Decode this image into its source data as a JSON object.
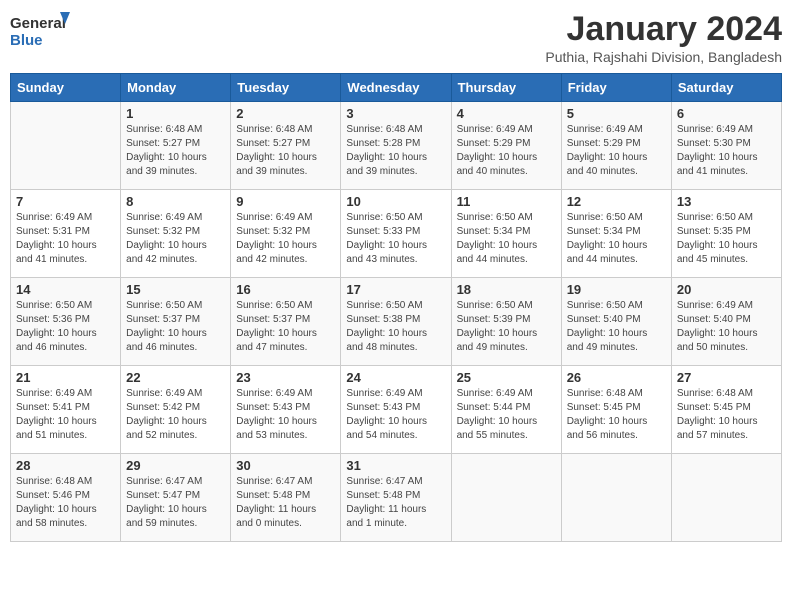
{
  "header": {
    "logo_line1": "General",
    "logo_line2": "Blue",
    "title": "January 2024",
    "subtitle": "Puthia, Rajshahi Division, Bangladesh"
  },
  "days_of_week": [
    "Sunday",
    "Monday",
    "Tuesday",
    "Wednesday",
    "Thursday",
    "Friday",
    "Saturday"
  ],
  "weeks": [
    [
      {
        "num": "",
        "info": ""
      },
      {
        "num": "1",
        "info": "Sunrise: 6:48 AM\nSunset: 5:27 PM\nDaylight: 10 hours\nand 39 minutes."
      },
      {
        "num": "2",
        "info": "Sunrise: 6:48 AM\nSunset: 5:27 PM\nDaylight: 10 hours\nand 39 minutes."
      },
      {
        "num": "3",
        "info": "Sunrise: 6:48 AM\nSunset: 5:28 PM\nDaylight: 10 hours\nand 39 minutes."
      },
      {
        "num": "4",
        "info": "Sunrise: 6:49 AM\nSunset: 5:29 PM\nDaylight: 10 hours\nand 40 minutes."
      },
      {
        "num": "5",
        "info": "Sunrise: 6:49 AM\nSunset: 5:29 PM\nDaylight: 10 hours\nand 40 minutes."
      },
      {
        "num": "6",
        "info": "Sunrise: 6:49 AM\nSunset: 5:30 PM\nDaylight: 10 hours\nand 41 minutes."
      }
    ],
    [
      {
        "num": "7",
        "info": "Sunrise: 6:49 AM\nSunset: 5:31 PM\nDaylight: 10 hours\nand 41 minutes."
      },
      {
        "num": "8",
        "info": "Sunrise: 6:49 AM\nSunset: 5:32 PM\nDaylight: 10 hours\nand 42 minutes."
      },
      {
        "num": "9",
        "info": "Sunrise: 6:49 AM\nSunset: 5:32 PM\nDaylight: 10 hours\nand 42 minutes."
      },
      {
        "num": "10",
        "info": "Sunrise: 6:50 AM\nSunset: 5:33 PM\nDaylight: 10 hours\nand 43 minutes."
      },
      {
        "num": "11",
        "info": "Sunrise: 6:50 AM\nSunset: 5:34 PM\nDaylight: 10 hours\nand 44 minutes."
      },
      {
        "num": "12",
        "info": "Sunrise: 6:50 AM\nSunset: 5:34 PM\nDaylight: 10 hours\nand 44 minutes."
      },
      {
        "num": "13",
        "info": "Sunrise: 6:50 AM\nSunset: 5:35 PM\nDaylight: 10 hours\nand 45 minutes."
      }
    ],
    [
      {
        "num": "14",
        "info": "Sunrise: 6:50 AM\nSunset: 5:36 PM\nDaylight: 10 hours\nand 46 minutes."
      },
      {
        "num": "15",
        "info": "Sunrise: 6:50 AM\nSunset: 5:37 PM\nDaylight: 10 hours\nand 46 minutes."
      },
      {
        "num": "16",
        "info": "Sunrise: 6:50 AM\nSunset: 5:37 PM\nDaylight: 10 hours\nand 47 minutes."
      },
      {
        "num": "17",
        "info": "Sunrise: 6:50 AM\nSunset: 5:38 PM\nDaylight: 10 hours\nand 48 minutes."
      },
      {
        "num": "18",
        "info": "Sunrise: 6:50 AM\nSunset: 5:39 PM\nDaylight: 10 hours\nand 49 minutes."
      },
      {
        "num": "19",
        "info": "Sunrise: 6:50 AM\nSunset: 5:40 PM\nDaylight: 10 hours\nand 49 minutes."
      },
      {
        "num": "20",
        "info": "Sunrise: 6:49 AM\nSunset: 5:40 PM\nDaylight: 10 hours\nand 50 minutes."
      }
    ],
    [
      {
        "num": "21",
        "info": "Sunrise: 6:49 AM\nSunset: 5:41 PM\nDaylight: 10 hours\nand 51 minutes."
      },
      {
        "num": "22",
        "info": "Sunrise: 6:49 AM\nSunset: 5:42 PM\nDaylight: 10 hours\nand 52 minutes."
      },
      {
        "num": "23",
        "info": "Sunrise: 6:49 AM\nSunset: 5:43 PM\nDaylight: 10 hours\nand 53 minutes."
      },
      {
        "num": "24",
        "info": "Sunrise: 6:49 AM\nSunset: 5:43 PM\nDaylight: 10 hours\nand 54 minutes."
      },
      {
        "num": "25",
        "info": "Sunrise: 6:49 AM\nSunset: 5:44 PM\nDaylight: 10 hours\nand 55 minutes."
      },
      {
        "num": "26",
        "info": "Sunrise: 6:48 AM\nSunset: 5:45 PM\nDaylight: 10 hours\nand 56 minutes."
      },
      {
        "num": "27",
        "info": "Sunrise: 6:48 AM\nSunset: 5:45 PM\nDaylight: 10 hours\nand 57 minutes."
      }
    ],
    [
      {
        "num": "28",
        "info": "Sunrise: 6:48 AM\nSunset: 5:46 PM\nDaylight: 10 hours\nand 58 minutes."
      },
      {
        "num": "29",
        "info": "Sunrise: 6:47 AM\nSunset: 5:47 PM\nDaylight: 10 hours\nand 59 minutes."
      },
      {
        "num": "30",
        "info": "Sunrise: 6:47 AM\nSunset: 5:48 PM\nDaylight: 11 hours\nand 0 minutes."
      },
      {
        "num": "31",
        "info": "Sunrise: 6:47 AM\nSunset: 5:48 PM\nDaylight: 11 hours\nand 1 minute."
      },
      {
        "num": "",
        "info": ""
      },
      {
        "num": "",
        "info": ""
      },
      {
        "num": "",
        "info": ""
      }
    ]
  ]
}
